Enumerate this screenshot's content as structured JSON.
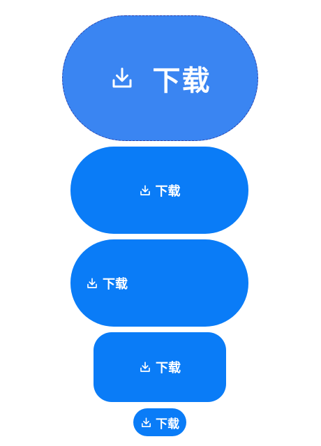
{
  "buttons": [
    {
      "label": "下载",
      "icon": "download-icon",
      "state": "selected"
    },
    {
      "label": "下载",
      "icon": "download-icon",
      "content_align": "center"
    },
    {
      "label": "下载",
      "icon": "download-icon",
      "content_align": "left"
    },
    {
      "label": "下载",
      "icon": "download-icon",
      "content_align": "center"
    },
    {
      "label": "下载",
      "icon": "download-icon",
      "content_align": "center"
    }
  ],
  "colors": {
    "primary_selected": "#3a85f2",
    "primary": "#0a7cf7",
    "selection_outline": "#2b3fa8",
    "text": "#ffffff"
  }
}
